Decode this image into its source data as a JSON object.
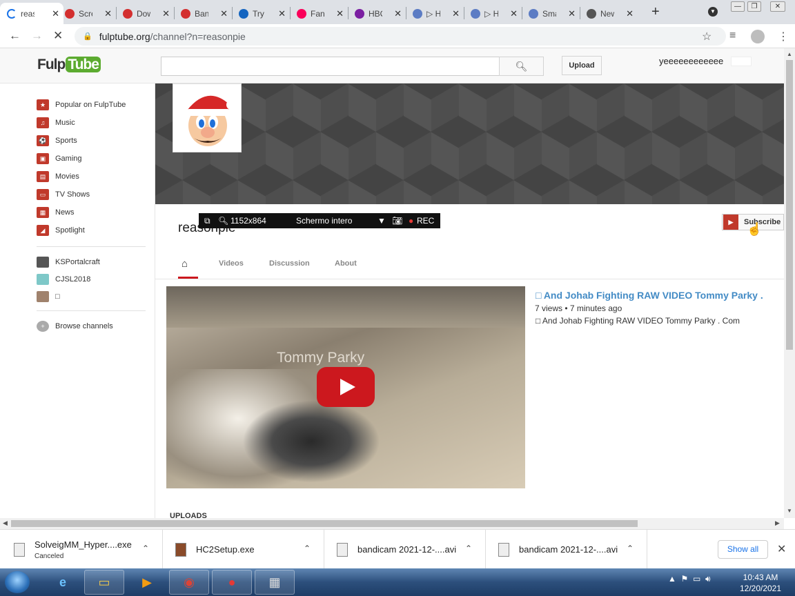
{
  "browser": {
    "tabs": [
      {
        "title": "reasonpie",
        "icon": "loading-spinner-icon",
        "color": "#1a73e8",
        "active": true
      },
      {
        "title": "Screen",
        "icon": "record-icon",
        "color": "#d32f2f",
        "active": false
      },
      {
        "title": "Download",
        "icon": "record-icon",
        "color": "#d32f2f",
        "active": false
      },
      {
        "title": "Bandicam",
        "icon": "record-icon",
        "color": "#d32f2f",
        "active": false
      },
      {
        "title": "Try",
        "icon": "m-logo-icon",
        "color": "#1565c0",
        "active": false
      },
      {
        "title": "Fandom",
        "icon": "fandom-icon",
        "color": "#fa005a",
        "active": false
      },
      {
        "title": "HBO",
        "icon": "m-logo-icon",
        "color": "#7b1fa2",
        "active": false
      },
      {
        "title": "▷ H",
        "icon": "globe-icon",
        "color": "#5c7cc4",
        "active": false
      },
      {
        "title": "▷ H",
        "icon": "globe-icon",
        "color": "#5c7cc4",
        "active": false
      },
      {
        "title": "Sma",
        "icon": "globe-icon",
        "color": "#5c7cc4",
        "active": false
      },
      {
        "title": "New",
        "icon": "chrome-icon",
        "color": "#555555",
        "active": false
      }
    ],
    "url_host": "fulptube.org",
    "url_path": "/channel?n=reasonpie"
  },
  "site": {
    "logo_left": "Fulp",
    "logo_right": "Tube",
    "upload_label": "Upload",
    "username": "yeeeeeeeeeeee",
    "search_placeholder": ""
  },
  "sidebar": {
    "categories": [
      {
        "label": "Popular on FulpTube",
        "icon": "star-icon"
      },
      {
        "label": "Music",
        "icon": "headphones-icon"
      },
      {
        "label": "Sports",
        "icon": "ball-icon"
      },
      {
        "label": "Gaming",
        "icon": "gamepad-icon"
      },
      {
        "label": "Movies",
        "icon": "film-icon"
      },
      {
        "label": "TV Shows",
        "icon": "tv-icon"
      },
      {
        "label": "News",
        "icon": "newspaper-icon"
      },
      {
        "label": "Spotlight",
        "icon": "spotlight-icon"
      }
    ],
    "subscriptions": [
      {
        "label": "KSPortalcraft"
      },
      {
        "label": "CJSL2018"
      },
      {
        "label": "□"
      }
    ],
    "browse_label": "Browse channels"
  },
  "channel": {
    "name": "reasonpie",
    "subscribe_label": "Subscribe",
    "tabs": [
      "Videos",
      "Discussion",
      "About"
    ],
    "uploads_label": "UPLOADS"
  },
  "featured_video": {
    "title": "□ And Johab Fighting RAW VIDEO Tommy Parky .",
    "views": "7 views",
    "age": "7 minutes ago",
    "description": "□ And Johab Fighting RAW VIDEO Tommy Parky . Com",
    "overlay_text": "Tommy Parky"
  },
  "recorder_overlay": {
    "resolution": "1152x864",
    "mode": "Schermo intero",
    "rec_label": "REC"
  },
  "downloads": [
    {
      "name": "SolveigMM_Hyper....exe",
      "status": "Canceled"
    },
    {
      "name": "HC2Setup.exe",
      "status": ""
    },
    {
      "name": "bandicam 2021-12-....avi",
      "status": ""
    },
    {
      "name": "bandicam 2021-12-....avi",
      "status": ""
    }
  ],
  "show_all_label": "Show all",
  "taskbar": {
    "time": "10:43 AM",
    "date": "12/20/2021"
  }
}
